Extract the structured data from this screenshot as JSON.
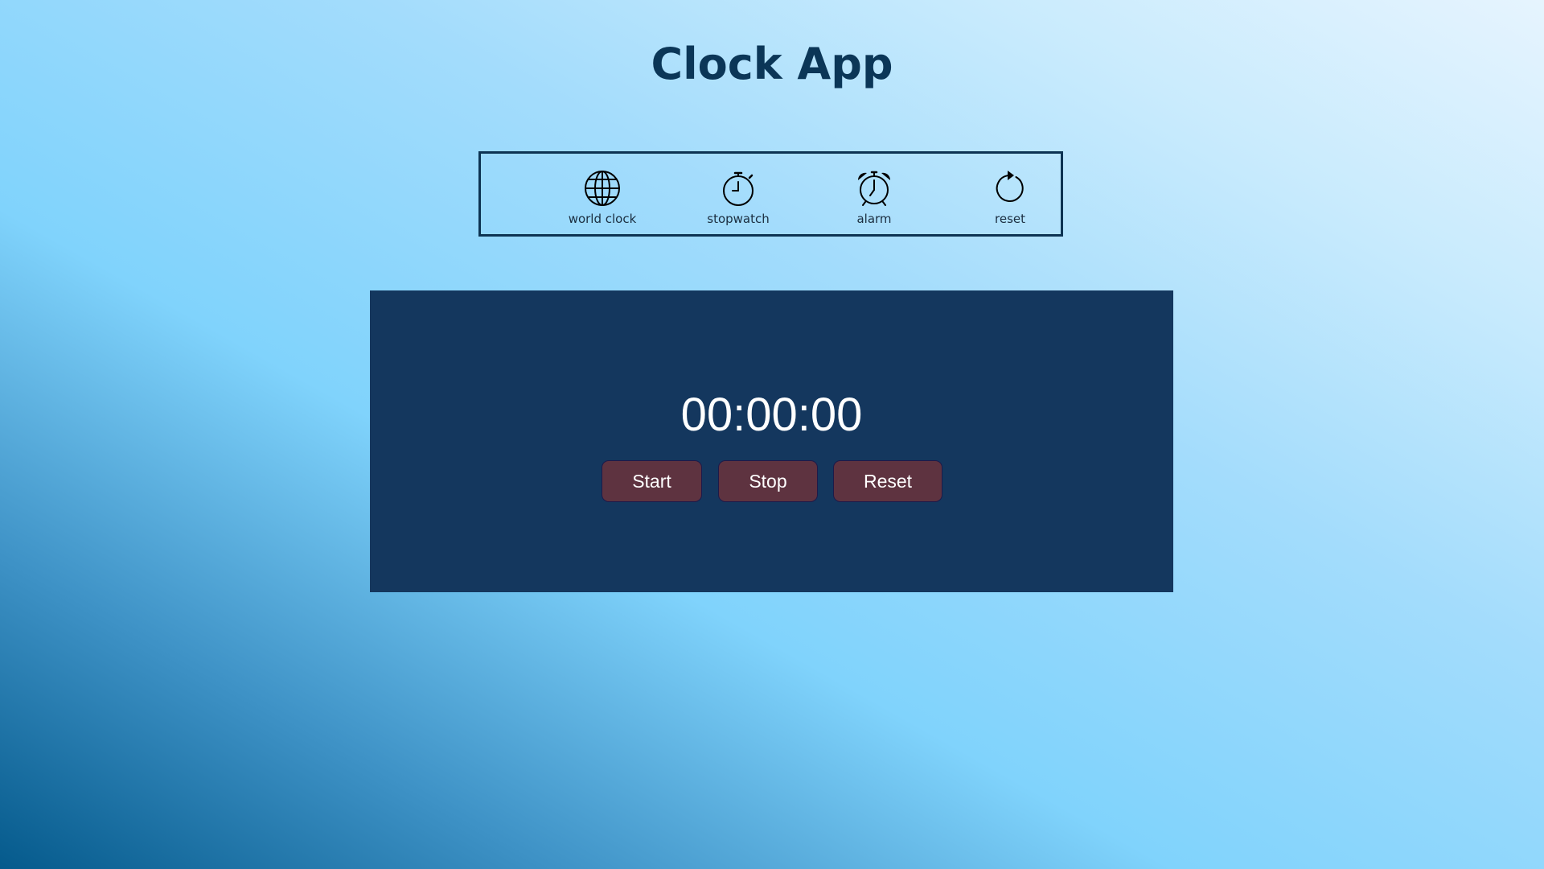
{
  "app": {
    "title": "Clock App"
  },
  "nav": {
    "items": [
      {
        "label": "world clock",
        "icon": "globe-icon"
      },
      {
        "label": "stopwatch",
        "icon": "stopwatch-icon"
      },
      {
        "label": "alarm",
        "icon": "alarm-clock-icon"
      },
      {
        "label": "reset",
        "icon": "reset-icon"
      }
    ]
  },
  "stopwatch": {
    "time": "00:00:00",
    "buttons": {
      "start": "Start",
      "stop": "Stop",
      "reset": "Reset"
    }
  },
  "colors": {
    "title": "#0b3657",
    "panel_background": "#14375e",
    "button_background": "#5e3340",
    "nav_border": "#0d3352"
  }
}
